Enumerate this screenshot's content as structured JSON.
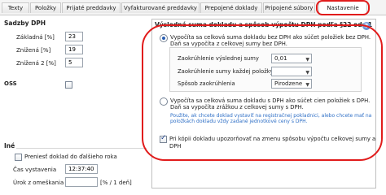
{
  "tabs": [
    {
      "label": "Texty"
    },
    {
      "label": "Položky"
    },
    {
      "label": "Prijaté preddavky"
    },
    {
      "label": "Vyfakturované preddavky"
    },
    {
      "label": "Prepojené doklady"
    },
    {
      "label": "Pripojené súbory"
    },
    {
      "label": "Nastavenie"
    }
  ],
  "vat_rates": {
    "title": "Sadzby DPH",
    "base_label": "Základná [%]",
    "base_value": "23",
    "reduced_label": "Znížená [%]",
    "reduced_value": "19",
    "reduced2_label": "Znížená 2 [%]",
    "reduced2_value": "5"
  },
  "oss": {
    "label": "OSS"
  },
  "other": {
    "title": "Iné",
    "transfer_label": "Preniesť doklad do ďalšieho roka",
    "time_label": "Čas vystavenia",
    "time_value": "12:37:40",
    "late_interest_label": "Úrok z omeškania",
    "late_interest_value": "",
    "late_interest_unit": "[% / 1 deň]"
  },
  "sum_group": {
    "title": "Výsledná suma dokladu a spôsob výpočtu DPH podľa §22 ods.1",
    "help_icon": "?",
    "option1_line1": "Vypočíta sa celková suma dokladu bez DPH ako súčet položiek bez DPH.",
    "option1_line2": "Daň sa vypočíta z celkovej sumy bez DPH.",
    "rounding_total_label": "Zaokrúhlenie výslednej sumy",
    "rounding_total_value": "0,01",
    "rounding_item_label": "Zaokrúhlenie sumy každej položky",
    "rounding_item_value": "",
    "rounding_method_label": "Spôsob zaokrúhlenia",
    "rounding_method_value": "Pirodzene",
    "option2_line1": "Vypočíta sa celková suma dokladu s DPH ako súčet cien položiek s DPH.",
    "option2_line2": "Daň sa vypočíta zrážkou z celkovej sumy s DPH.",
    "option2_note1": "Použite, ak chcete doklad vystaviť na registračnej pokladnici, alebo chcete mať na",
    "option2_note2": "položkách dokladu vždy zadané jednotkové ceny s DPH.",
    "warn_label": "Pri kópii dokladu upozorňovať na zmenu spôsobu výpočtu celkovej sumy a DPH"
  },
  "colors": {
    "highlight": "#e11b1b",
    "link_text": "#2e6fc6"
  }
}
